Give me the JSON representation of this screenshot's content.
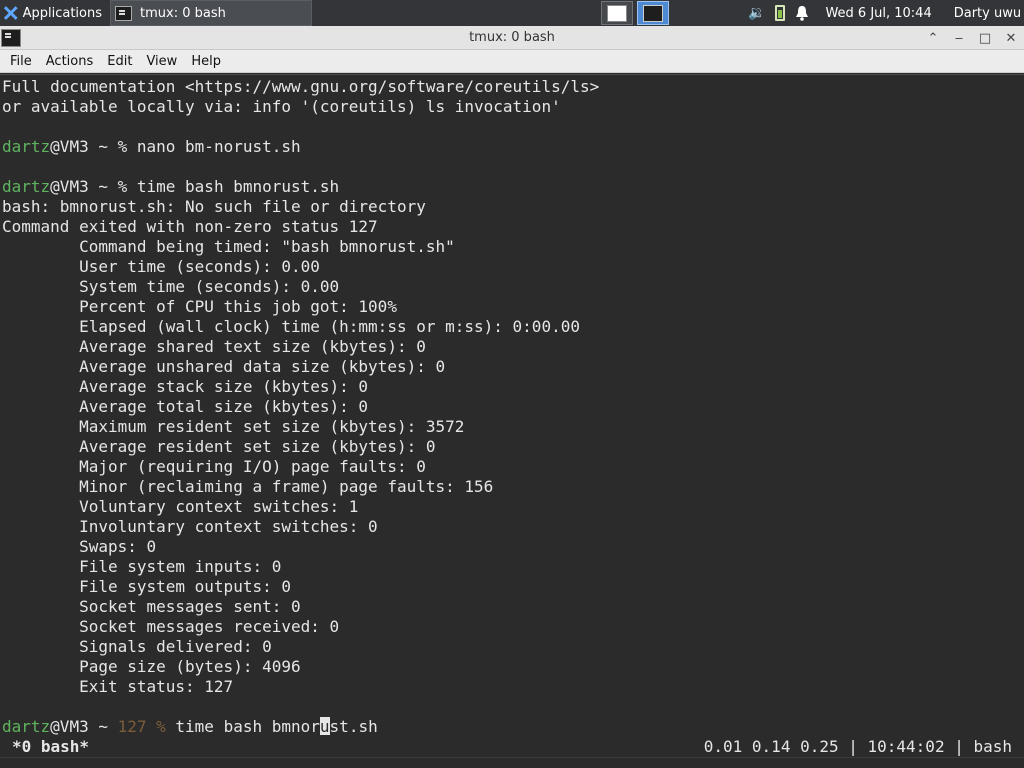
{
  "panel": {
    "apps_label": "Applications",
    "task_label": "tmux: 0 bash",
    "clock": "Wed  6 Jul, 10:44",
    "user": "Darty uwu",
    "icons": [
      "xfce-logo-icon",
      "terminal-icon",
      "volume-icon",
      "battery-icon",
      "bell-icon"
    ]
  },
  "window": {
    "title": "tmux: 0 bash"
  },
  "menubar": {
    "items": [
      "File",
      "Actions",
      "Edit",
      "View",
      "Help"
    ]
  },
  "terminal": {
    "lines": [
      "Full documentation <https://www.gnu.org/software/coreutils/ls>",
      "or available locally via: info '(coreutils) ls invocation'",
      "",
      "PROMPT1",
      "",
      "PROMPT2",
      "bash: bmnorust.sh: No such file or directory",
      "Command exited with non-zero status 127",
      "        Command being timed: \"bash bmnorust.sh\"",
      "        User time (seconds): 0.00",
      "        System time (seconds): 0.00",
      "        Percent of CPU this job got: 100%",
      "        Elapsed (wall clock) time (h:mm:ss or m:ss): 0:00.00",
      "        Average shared text size (kbytes): 0",
      "        Average unshared data size (kbytes): 0",
      "        Average stack size (kbytes): 0",
      "        Average total size (kbytes): 0",
      "        Maximum resident set size (kbytes): 3572",
      "        Average resident set size (kbytes): 0",
      "        Major (requiring I/O) page faults: 0",
      "        Minor (reclaiming a frame) page faults: 156",
      "        Voluntary context switches: 1",
      "        Involuntary context switches: 0",
      "        Swaps: 0",
      "        File system inputs: 0",
      "        File system outputs: 0",
      "        Socket messages sent: 0",
      "        Socket messages received: 0",
      "        Signals delivered: 0",
      "        Page size (bytes): 4096",
      "        Exit status: 127",
      "",
      "PROMPT3"
    ],
    "prompts": {
      "p1": {
        "user": "dartz",
        "host": "@VM3 ~ % ",
        "cmd": "nano bm-norust.sh"
      },
      "p2": {
        "user": "dartz",
        "host": "@VM3 ~ % ",
        "cmd": "time bash bmnorust.sh"
      },
      "p3": {
        "user": "dartz",
        "host": "@VM3 ~ ",
        "status": "127 % ",
        "cmd_before": "time bash bmnor",
        "cursor_char": "u",
        "cmd_after": "st.sh"
      }
    }
  },
  "status_bar": {
    "left": "*0 bash*",
    "right": "0.01 0.14 0.25 | 10:44:02 | bash"
  }
}
